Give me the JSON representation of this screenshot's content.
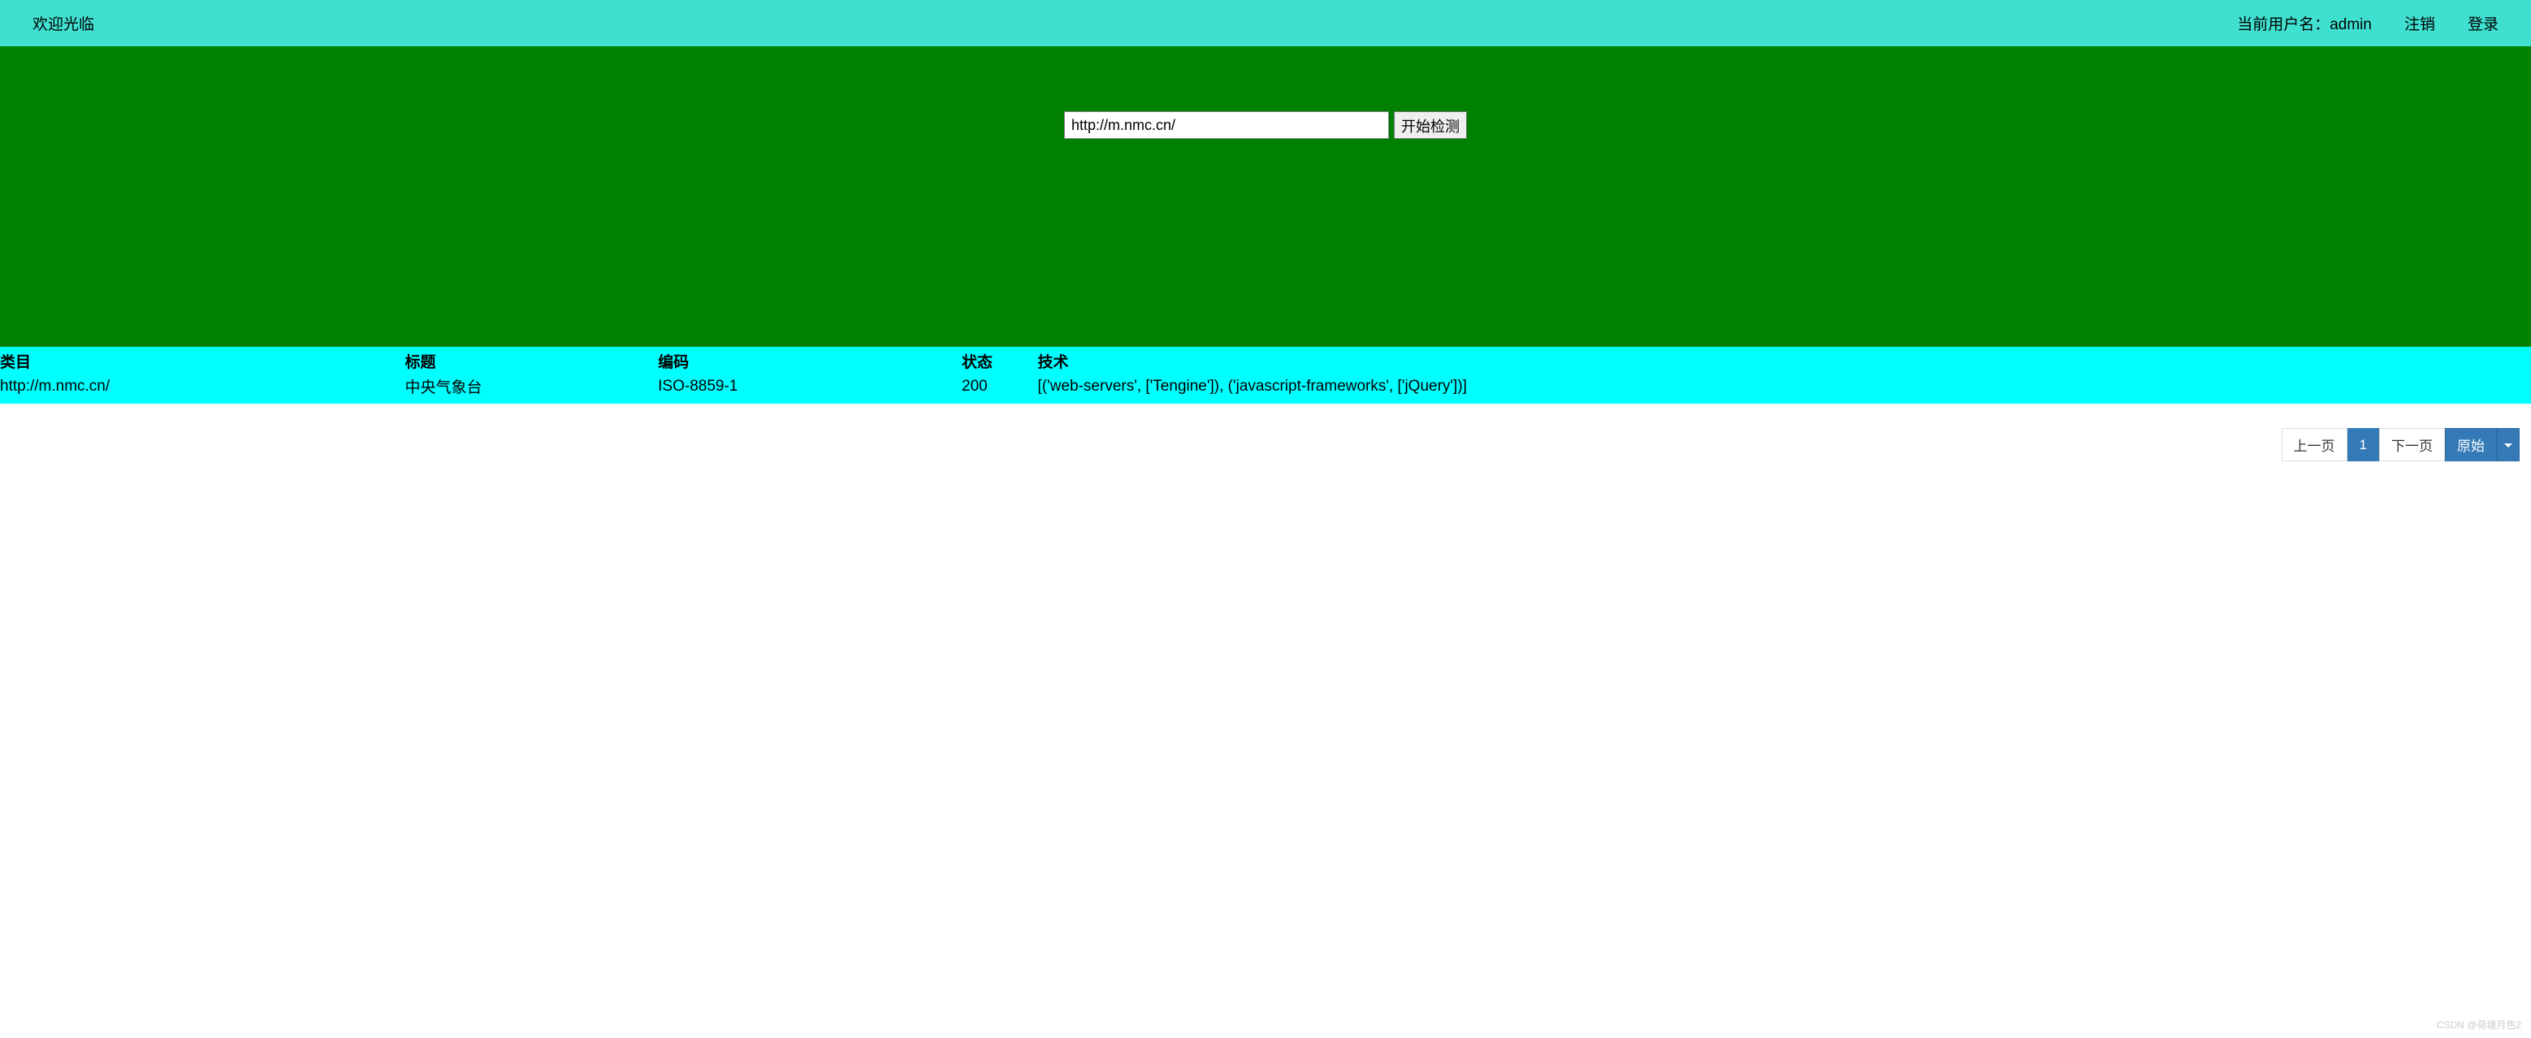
{
  "header": {
    "welcome": "欢迎光临",
    "user_label": "当前用户名：admin",
    "logout": "注销",
    "login": "登录"
  },
  "search": {
    "value": "http://m.nmc.cn/",
    "button": "开始检测"
  },
  "table": {
    "headers": {
      "category": "类目",
      "title": "标题",
      "encoding": "编码",
      "status": "状态",
      "tech": "技术"
    },
    "row": {
      "category": "http://m.nmc.cn/",
      "title": "中央气象台",
      "encoding": "ISO-8859-1",
      "status": "200",
      "tech": "[('web-servers', ['Tengine']), ('javascript-frameworks', ['jQuery'])]"
    }
  },
  "pagination": {
    "prev": "上一页",
    "page": "1",
    "next": "下一页",
    "raw": "原始"
  },
  "watermark": "CSDN @荷塘月色2"
}
